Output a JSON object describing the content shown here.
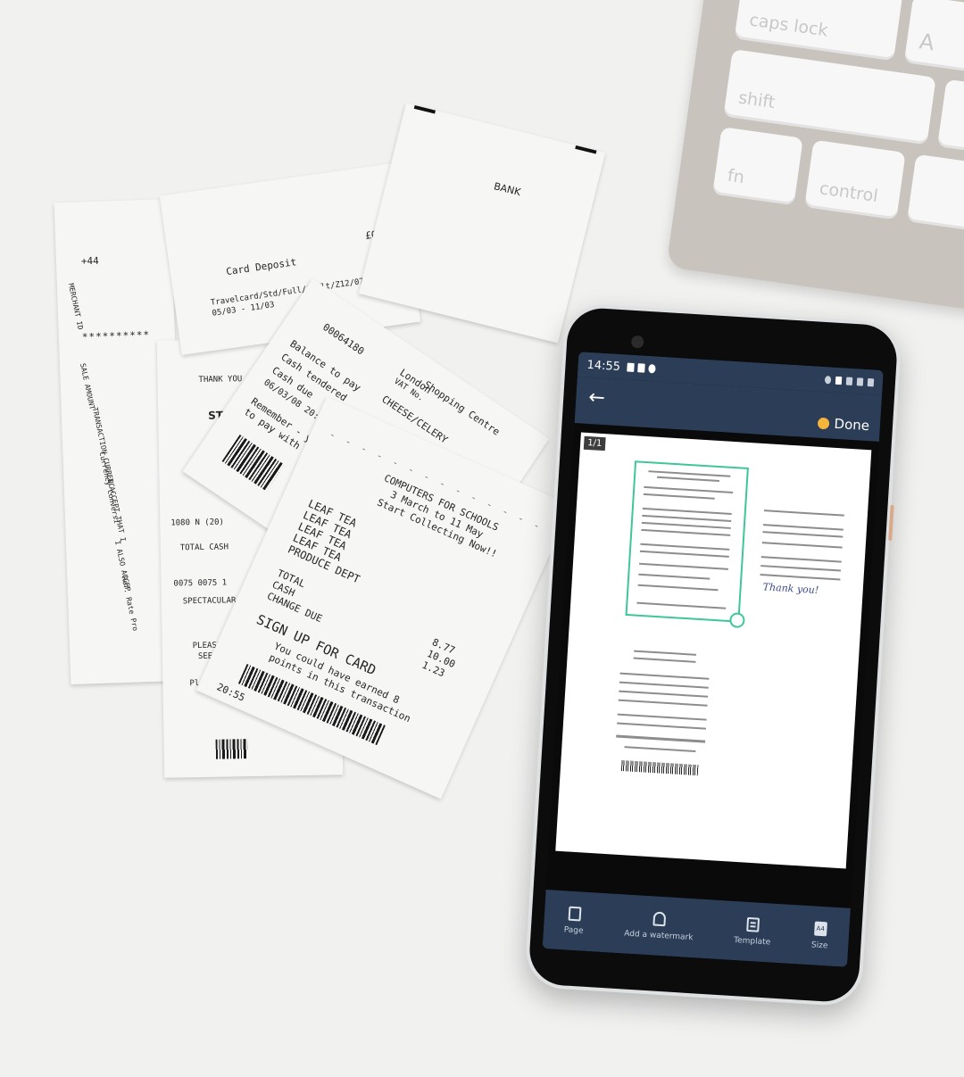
{
  "keyboard": {
    "keys": [
      "caps lock",
      "shift",
      "fn",
      "control",
      "A"
    ]
  },
  "receipts": {
    "bank_label": "BANK",
    "card_deposit": "Card Deposit",
    "amount_zero": "£0.00",
    "travelcard": "Travelcard/Std/Full/Adult/Z12/07Days",
    "dates": "05/03 - 11/03",
    "merchant": "+44",
    "thank_you": "THANK YOU FOR SHOPPING",
    "styling": "STYLING",
    "shopping_centre": "Shopping Centre",
    "london": "London",
    "vat": "VAT No.",
    "cheese": "CHEESE/CELERY",
    "balance": "Balance to pay",
    "cash_tendered": "Cash tendered",
    "cash_due": "Cash due",
    "date_time": "06/03/08 20:01 096",
    "remember": "Remember - you ne",
    "pay_with": "to pay with your",
    "computers": "COMPUTERS FOR SCHOOLS",
    "march": "3 March to 11 May",
    "start_collecting": "Start Collecting Now!!",
    "leaf_tea": "LEAF TEA",
    "produce": "PRODUCE DEPT",
    "total": "TOTAL",
    "cash": "CASH",
    "change_due": "CHANGE DUE",
    "sign_up": "SIGN UP FOR CARD",
    "earned": "You could have earned 8",
    "points": "points in this transaction",
    "totals_vals": [
      "8.77",
      "10.00",
      "1.23"
    ],
    "time": "20:55",
    "spectacular": "SPECTACULAR",
    "please_retain": "PLEASE RETAIN",
    "see_reverse": "SEE REVERSE",
    "please_note": "Please note",
    "currency": "Currency Conversi",
    "sale_amount": "SALE AMOUNT",
    "transaction": "TRANSACTION CURRENC",
    "accept": "I ACCEPT THAT I",
    "also_accept": "I ALSO ACCEP",
    "rate": "Ref. Rate Pro",
    "code": "0075 0075 1",
    "total_cash": "TOTAL CASH",
    "num_1080": "1080 N (20)"
  },
  "phone": {
    "status_time": "14:55",
    "done_label": "Done",
    "page_badge": "1/1",
    "signature": "Thank you!",
    "toolbar": [
      {
        "label": "Page",
        "icon": "page-icon"
      },
      {
        "label": "Add a watermark",
        "icon": "watermark-icon"
      },
      {
        "label": "Template",
        "icon": "template-icon"
      },
      {
        "label": "Size",
        "icon": "size-icon",
        "glyph": "A4"
      }
    ]
  }
}
